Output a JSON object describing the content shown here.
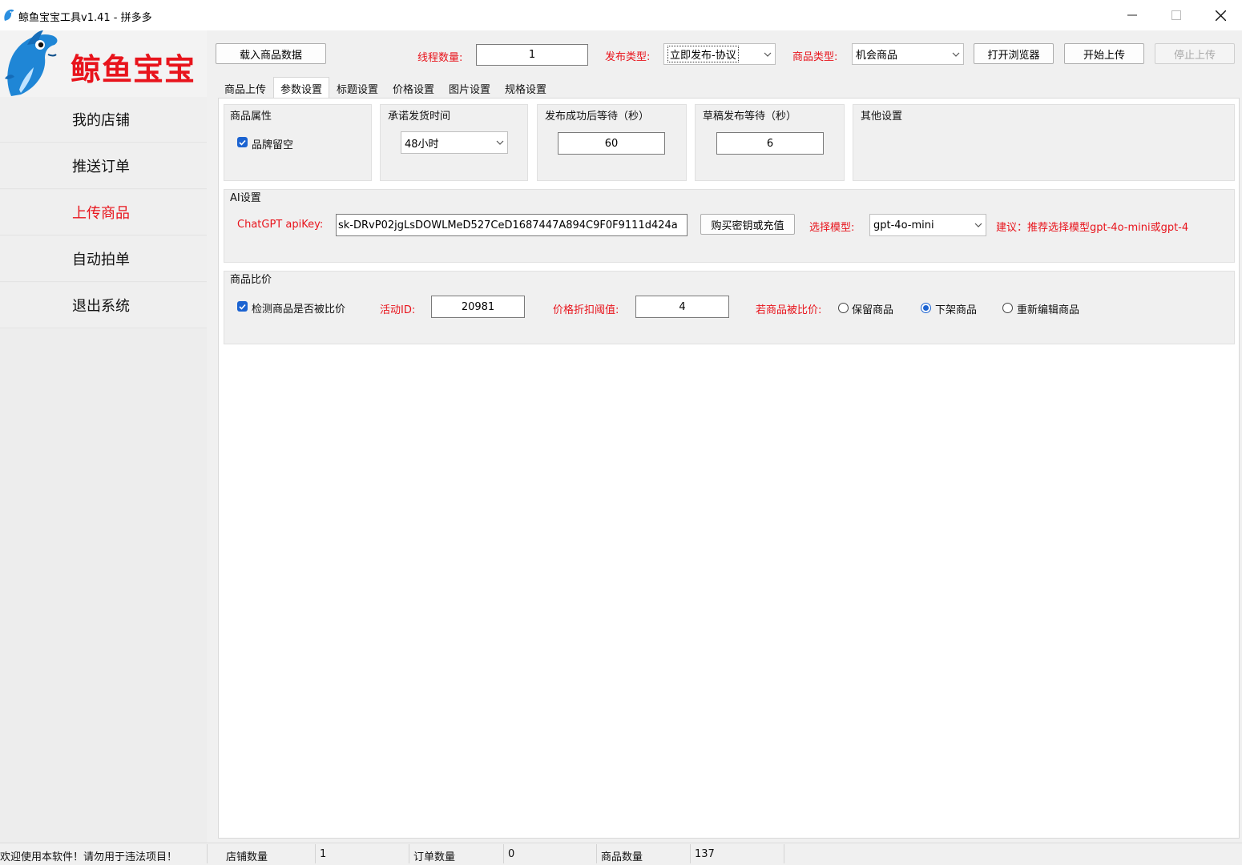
{
  "window": {
    "title": "鲸鱼宝宝工具v1.41 - 拼多多"
  },
  "sidebar": {
    "logo_text": "鲸鱼宝宝",
    "items": [
      {
        "label": "我的店铺",
        "active": false
      },
      {
        "label": "推送订单",
        "active": false
      },
      {
        "label": "上传商品",
        "active": true
      },
      {
        "label": "自动拍单",
        "active": false
      },
      {
        "label": "退出系统",
        "active": false
      }
    ]
  },
  "toolbar": {
    "load_button": "载入商品数据",
    "thread_label": "线程数量:",
    "thread_value": "1",
    "publish_type_label": "发布类型:",
    "publish_type_value": "立即发布-协议",
    "product_type_label": "商品类型:",
    "product_type_value": "机会商品",
    "open_browser_button": "打开浏览器",
    "start_upload_button": "开始上传",
    "stop_upload_button": "停止上传"
  },
  "tabs": [
    {
      "label": "商品上传",
      "active": false
    },
    {
      "label": "参数设置",
      "active": true
    },
    {
      "label": "标题设置",
      "active": false
    },
    {
      "label": "价格设置",
      "active": false
    },
    {
      "label": "图片设置",
      "active": false
    },
    {
      "label": "规格设置",
      "active": false
    }
  ],
  "settings": {
    "product_attr": {
      "title": "商品属性",
      "brand_empty_label": "品牌留空",
      "brand_empty_checked": true
    },
    "ship_time": {
      "title": "承诺发货时间",
      "value": "48小时"
    },
    "publish_wait": {
      "title": "发布成功后等待（秒）",
      "value": "60"
    },
    "draft_wait": {
      "title": "草稿发布等待（秒）",
      "value": "6"
    },
    "other": {
      "title": "其他设置"
    },
    "ai": {
      "title": "AI设置",
      "apikey_label": "ChatGPT apiKey:",
      "apikey_value": "sk-DRvP02jgLsDOWLMeD527CeD1687447A894C9F0F9111d424a",
      "buy_key_button": "购买密钥或充值",
      "model_label": "选择模型:",
      "model_value": "gpt-4o-mini",
      "suggestion": "建议：推荐选择模型gpt-4o-mini或gpt-4"
    },
    "compare": {
      "title": "商品比价",
      "detect_label": "检测商品是否被比价",
      "detect_checked": true,
      "activity_label": "活动ID:",
      "activity_value": "20981",
      "threshold_label": "价格折扣阈值:",
      "threshold_value": "4",
      "if_compared_label": "若商品被比价:",
      "options": [
        {
          "label": "保留商品",
          "selected": false
        },
        {
          "label": "下架商品",
          "selected": true
        },
        {
          "label": "重新编辑商品",
          "selected": false
        }
      ]
    }
  },
  "statusbar": {
    "welcome": "欢迎使用本软件！请勿用于违法项目！",
    "shop_count_label": "店铺数量",
    "shop_count_value": "1",
    "order_count_label": "订单数量",
    "order_count_value": "0",
    "product_count_label": "商品数量",
    "product_count_value": "137"
  },
  "colors": {
    "accent_red": "#e8141c",
    "check_blue": "#1b63d1"
  }
}
